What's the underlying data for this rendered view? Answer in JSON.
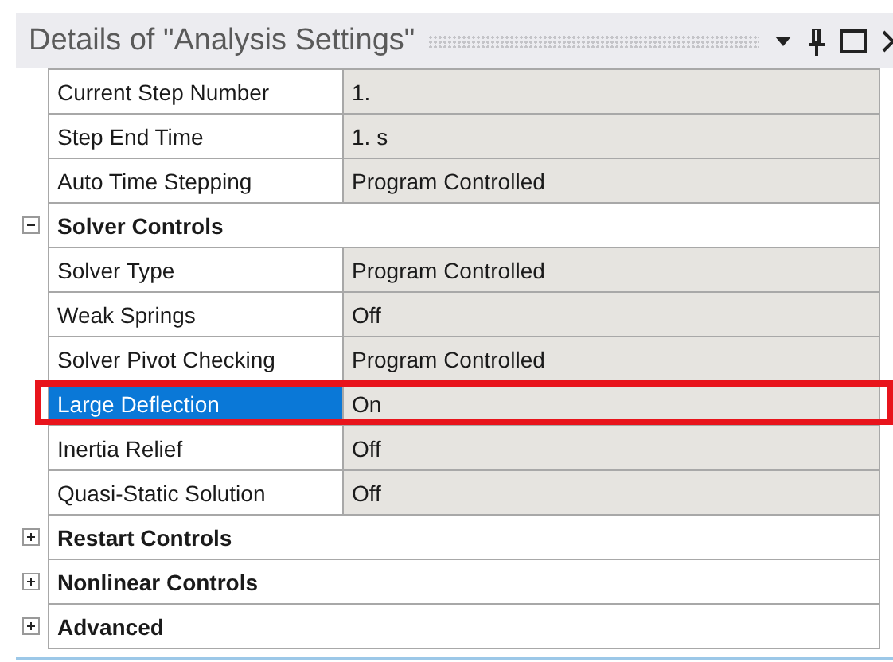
{
  "panel": {
    "title": "Details of \"Analysis Settings\""
  },
  "rows": [
    {
      "kind": "property",
      "label": "Current Step Number",
      "value": "1.",
      "selected": false,
      "annotated": false
    },
    {
      "kind": "property",
      "label": "Step End Time",
      "value": "1. s",
      "selected": false,
      "annotated": false
    },
    {
      "kind": "property",
      "label": "Auto Time Stepping",
      "value": "Program Controlled",
      "selected": false,
      "annotated": false
    },
    {
      "kind": "group",
      "label": "Solver Controls",
      "expanded": true,
      "children": [
        {
          "kind": "property",
          "label": "Solver Type",
          "value": "Program Controlled",
          "selected": false,
          "annotated": false
        },
        {
          "kind": "property",
          "label": "Weak Springs",
          "value": "Off",
          "selected": false,
          "annotated": false
        },
        {
          "kind": "property",
          "label": "Solver Pivot Checking",
          "value": "Program Controlled",
          "selected": false,
          "annotated": false
        },
        {
          "kind": "property",
          "label": "Large Deflection",
          "value": "On",
          "selected": true,
          "annotated": true
        },
        {
          "kind": "property",
          "label": "Inertia Relief",
          "value": "Off",
          "selected": false,
          "annotated": false
        },
        {
          "kind": "property",
          "label": "Quasi-Static Solution",
          "value": "Off",
          "selected": false,
          "annotated": false
        }
      ]
    },
    {
      "kind": "group",
      "label": "Restart Controls",
      "expanded": false,
      "children": []
    },
    {
      "kind": "group",
      "label": "Nonlinear Controls",
      "expanded": false,
      "children": []
    },
    {
      "kind": "group",
      "label": "Advanced",
      "expanded": false,
      "children": []
    }
  ]
}
